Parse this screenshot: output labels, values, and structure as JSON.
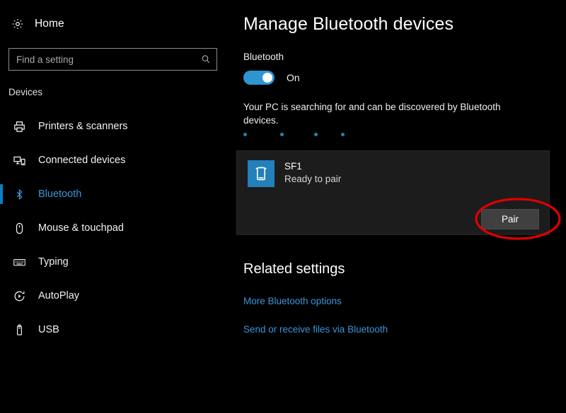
{
  "sidebar": {
    "home": {
      "label": "Home",
      "icon": "gear-icon"
    },
    "search": {
      "value": "",
      "placeholder": "Find a setting",
      "icon": "search-icon"
    },
    "section_label": "Devices",
    "items": [
      {
        "label": "Printers & scanners",
        "icon": "printer-icon",
        "selected": false
      },
      {
        "label": "Connected devices",
        "icon": "connected-devices-icon",
        "selected": false
      },
      {
        "label": "Bluetooth",
        "icon": "bluetooth-icon",
        "selected": true
      },
      {
        "label": "Mouse & touchpad",
        "icon": "mouse-icon",
        "selected": false
      },
      {
        "label": "Typing",
        "icon": "keyboard-icon",
        "selected": false
      },
      {
        "label": "AutoPlay",
        "icon": "autoplay-icon",
        "selected": false
      },
      {
        "label": "USB",
        "icon": "usb-icon",
        "selected": false
      }
    ]
  },
  "main": {
    "title": "Manage Bluetooth devices",
    "bluetooth_label": "Bluetooth",
    "toggle": {
      "state": "On",
      "checked": true
    },
    "status_text": "Your PC is searching for and can be discovered by Bluetooth devices.",
    "progress_dots": [
      0,
      52,
      100,
      138
    ],
    "device": {
      "name": "SF1",
      "status": "Ready to pair",
      "icon": "phone-icon",
      "action_label": "Pair"
    },
    "related": {
      "title": "Related settings",
      "links": [
        "More Bluetooth options",
        "Send or receive files via Bluetooth"
      ]
    }
  },
  "annotation": {
    "shape": "ellipse",
    "color": "#e00000",
    "target": "Pair"
  },
  "colors": {
    "background": "#000000",
    "accent": "#0d7ec4",
    "link": "#3a96d8",
    "toggle_on": "#2e95d3",
    "card": "#1c1c1c",
    "button": "#404040",
    "tile": "#2380ba",
    "annotation": "#e00000"
  }
}
